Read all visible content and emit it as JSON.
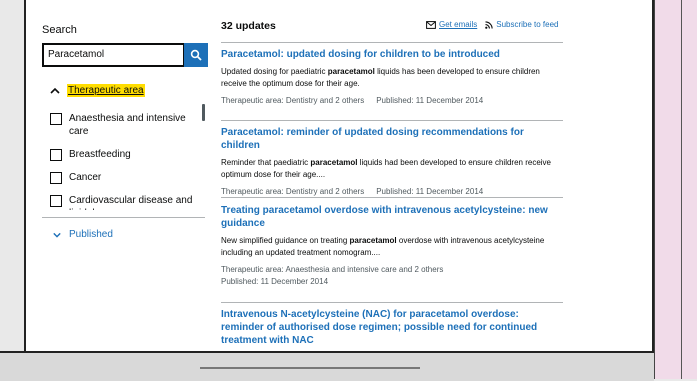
{
  "filters": {
    "search_label": "Search",
    "search_value": "Paracetamol",
    "section_title": "Therapeutic area",
    "options": [
      "Anaesthesia and intensive care",
      "Breastfeeding",
      "Cancer",
      "Cardiovascular disease and lipidology"
    ],
    "published_label": "Published"
  },
  "results": {
    "count": "32 updates",
    "get_emails": "Get emails",
    "subscribe": "Subscribe to feed",
    "items": [
      {
        "title": "Paracetamol: updated dosing for children to be introduced",
        "desc_pre": "Updated dosing for paediatric ",
        "desc_bold": "paracetamol",
        "desc_post": " liquids has been developed to ensure children receive the optimum dose for their age.",
        "area": "Therapeutic area: Dentistry and 2 others",
        "published": "Published: 11 December 2014"
      },
      {
        "title": "Paracetamol: reminder of updated dosing recommendations for children",
        "desc_pre": "Reminder that paediatric ",
        "desc_bold": "paracetamol",
        "desc_post": " liquids had been developed to ensure children receive optimum dose for their age....",
        "area": "Therapeutic area: Dentistry and 2 others",
        "published": "Published: 11 December 2014"
      },
      {
        "title": "Treating paracetamol overdose with intravenous acetylcysteine: new guidance",
        "desc_pre": "New simplified guidance on treating ",
        "desc_bold": "paracetamol",
        "desc_post": " overdose with intravenous acetylcysteine including an updated treatment nomogram....",
        "area": "Therapeutic area: Anaesthesia and intensive care and 2 others",
        "published": "Published: 11 December 2014"
      },
      {
        "title": "Intravenous N-acetylcysteine (NAC) for paracetamol overdose: reminder of authorised dose regimen; possible need for continued treatment with NAC"
      }
    ]
  }
}
